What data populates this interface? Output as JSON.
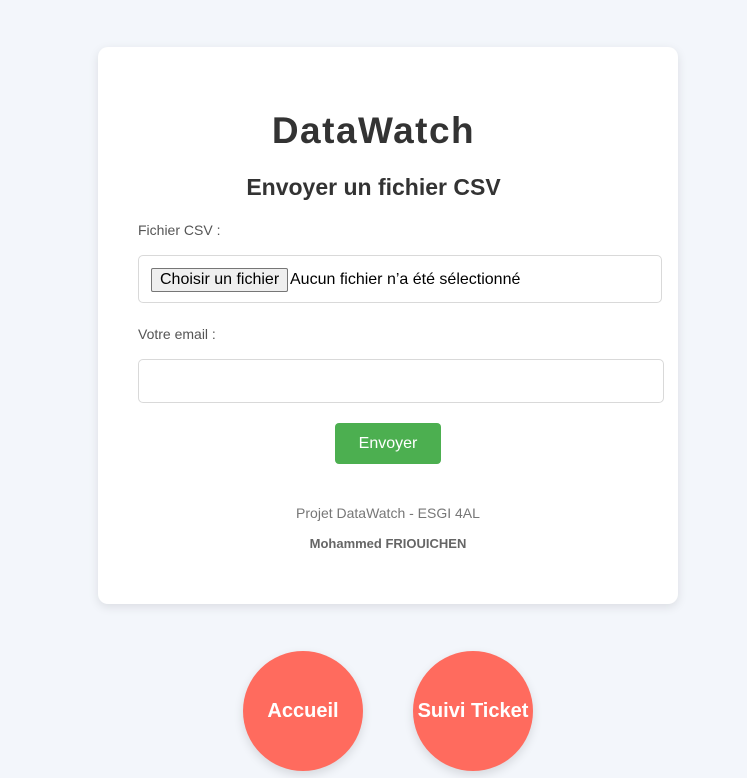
{
  "app": {
    "title": "DataWatch",
    "subtitle": "Envoyer un fichier CSV"
  },
  "form": {
    "file_label": "Fichier CSV :",
    "file_button": "Choisir un fichier",
    "file_status": "Aucun fichier n’a été sélectionné",
    "email_label": "Votre email :",
    "email_value": "",
    "email_placeholder": "",
    "submit_label": "Envoyer"
  },
  "footer": {
    "project": "Projet DataWatch - ESGI 4AL",
    "author": "Mohammed FRIOUICHEN"
  },
  "nav": {
    "home_label": "Accueil",
    "ticket_label": "Suivi Ticket"
  },
  "colors": {
    "background": "#f3f6fb",
    "card": "#ffffff",
    "submit": "#4caf50",
    "nav_circle": "#ff6b5e"
  }
}
